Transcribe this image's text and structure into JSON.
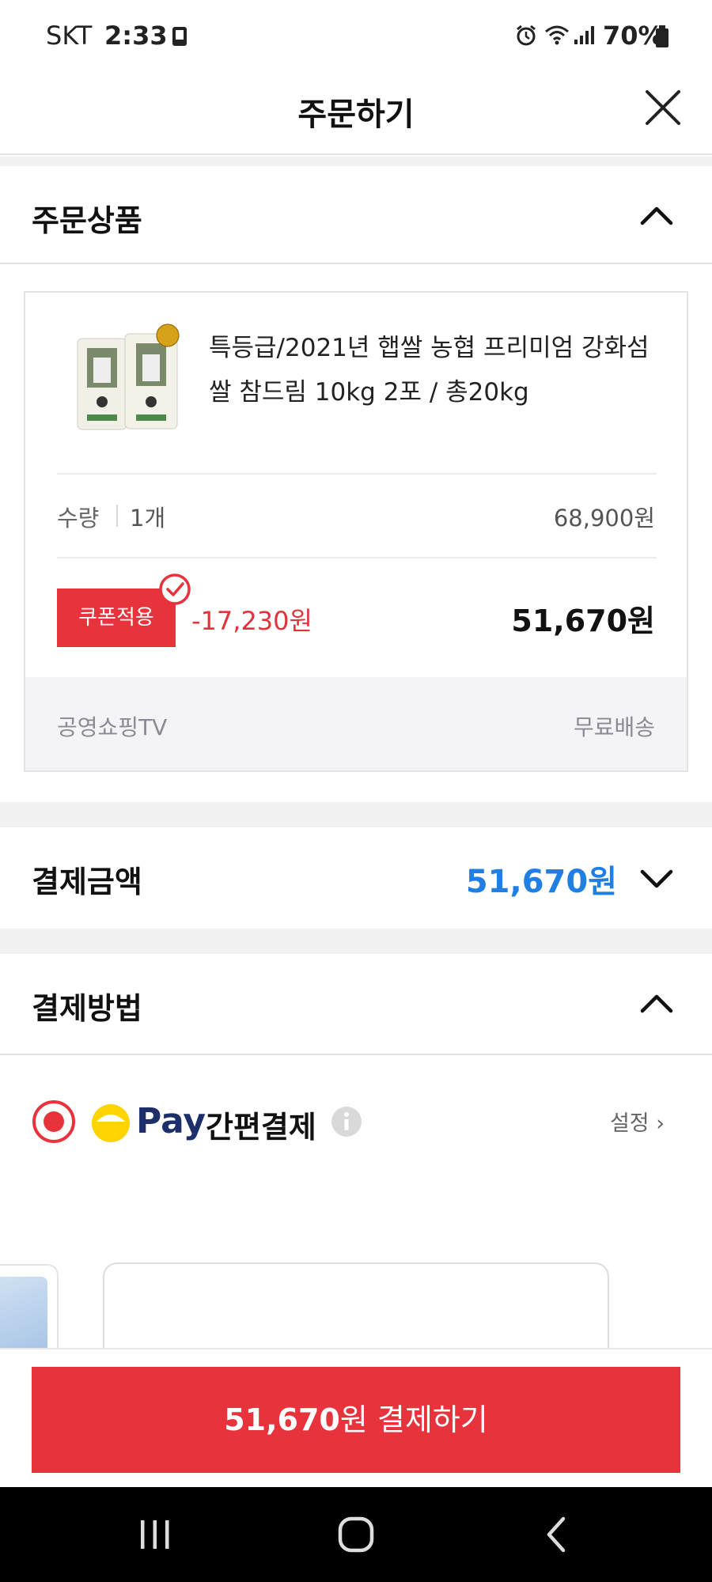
{
  "status_bar": {
    "carrier": "SKT",
    "time": "2:33",
    "battery": "70%"
  },
  "header": {
    "title": "주문하기"
  },
  "order_section": {
    "title": "주문상품"
  },
  "product": {
    "name": "특등급/2021년 햅쌀 농협 프리미엄 강화섬쌀 참드림 10kg 2포 / 총20kg",
    "quantity_label": "수량",
    "quantity_value": "1개",
    "original_price": "68,900원",
    "coupon_badge": "쿠폰적용",
    "discount": "-17,230원",
    "final_price": "51,670원",
    "seller": "공영쇼핑TV",
    "shipping": "무료배송"
  },
  "payment_amount": {
    "title": "결제금액",
    "value": "51,670원"
  },
  "payment_method": {
    "title": "결제방법",
    "pay_brand": "Pay",
    "option_label": "간편결제",
    "setting": "설정 ›"
  },
  "pay_button": {
    "amount": "51,670",
    "suffix": "원 결제하기"
  },
  "colors": {
    "accent_red": "#e8323c",
    "price_blue": "#1f7fe3",
    "pay_yellow": "#ffd400",
    "pay_navy": "#1d2f6b"
  },
  "icons": {
    "close": "close-icon",
    "chevron_up": "chevron-up-icon",
    "chevron_down": "chevron-down-icon",
    "check": "check-circle-icon",
    "radio": "radio-selected-icon",
    "info": "info-icon"
  }
}
